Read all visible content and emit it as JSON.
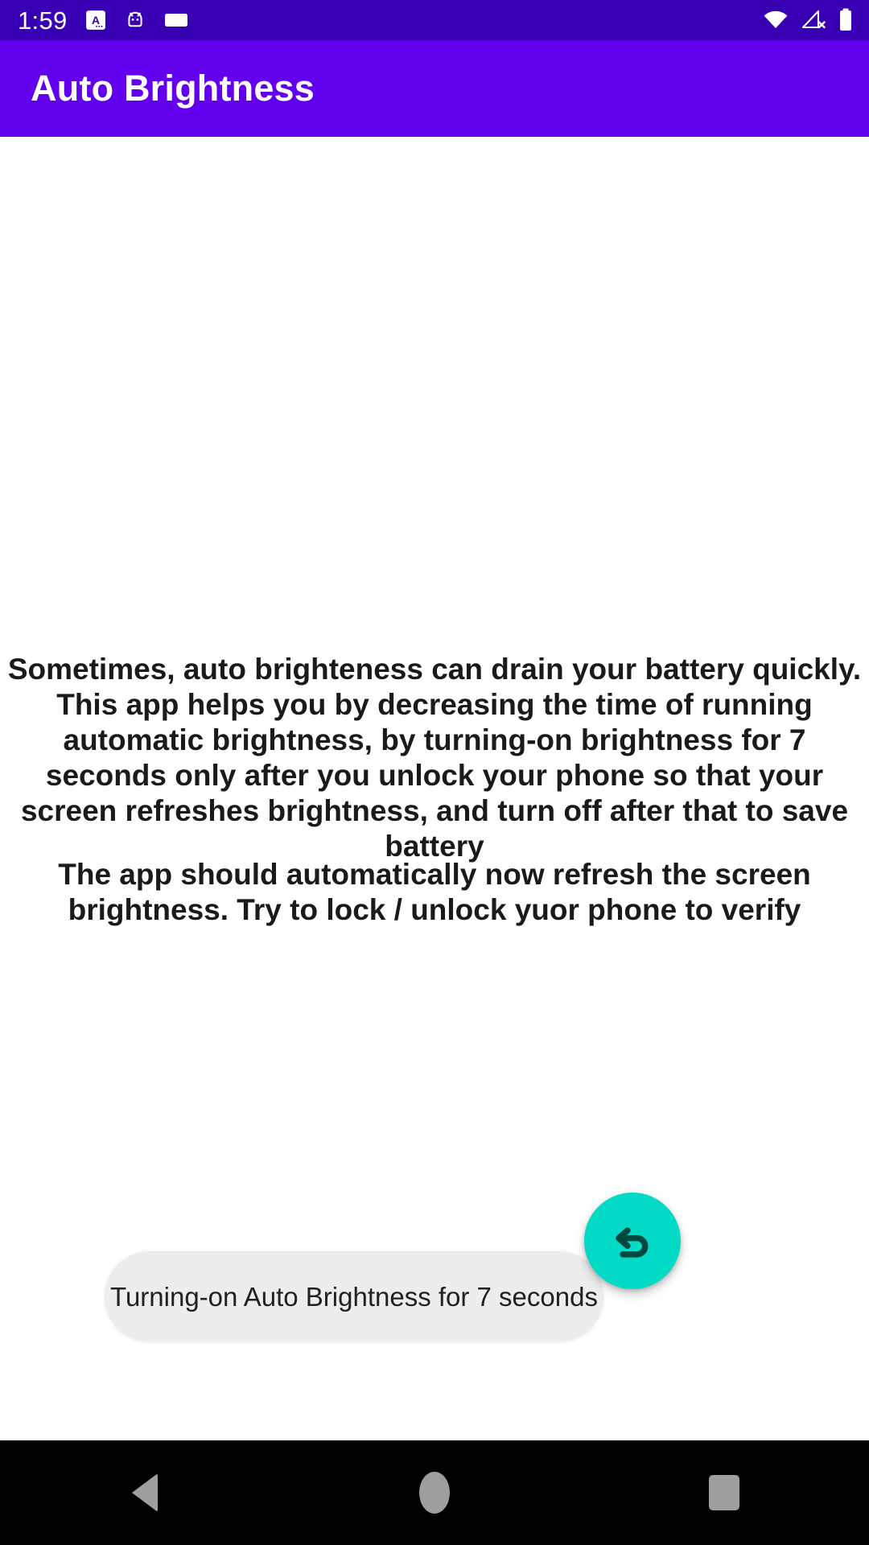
{
  "status_bar": {
    "time": "1:59",
    "background_color": "#3700B3",
    "notification_icons": [
      {
        "name": "app-badge-a-icon",
        "glyph": "A"
      },
      {
        "name": "android-robot-icon",
        "glyph": "android"
      },
      {
        "name": "blank-notification-icon",
        "glyph": "rect"
      }
    ],
    "system_icons": [
      {
        "name": "wifi-icon"
      },
      {
        "name": "cellular-no-signal-icon"
      },
      {
        "name": "battery-full-icon"
      }
    ]
  },
  "app_bar": {
    "title": "Auto Brightness",
    "background_color": "#6200EE",
    "text_color": "#FFFFFF"
  },
  "main": {
    "paragraph_1": "Sometimes, auto brighteness can drain your battery quickly. This app helps you by decreasing the time of running automatic brightness, by turning-on brightness for 7 seconds only after you unlock your phone so that your screen refreshes brightness, and turn off after that to save battery",
    "paragraph_2": "The app should automatically now refresh the screen brightness. Try to lock / unlock yuor phone to verify"
  },
  "toast": {
    "message": "Turning-on Auto Brightness for 7 seconds",
    "background_color": "#EDEDED",
    "text_color": "#212121"
  },
  "fab": {
    "icon_name": "undo-arrow-icon",
    "background_color": "#03DAC5",
    "icon_color": "#00483F"
  },
  "nav_bar": {
    "background_color": "#000000",
    "buttons": [
      {
        "name": "nav-back-button"
      },
      {
        "name": "nav-home-button"
      },
      {
        "name": "nav-recents-button"
      }
    ]
  }
}
